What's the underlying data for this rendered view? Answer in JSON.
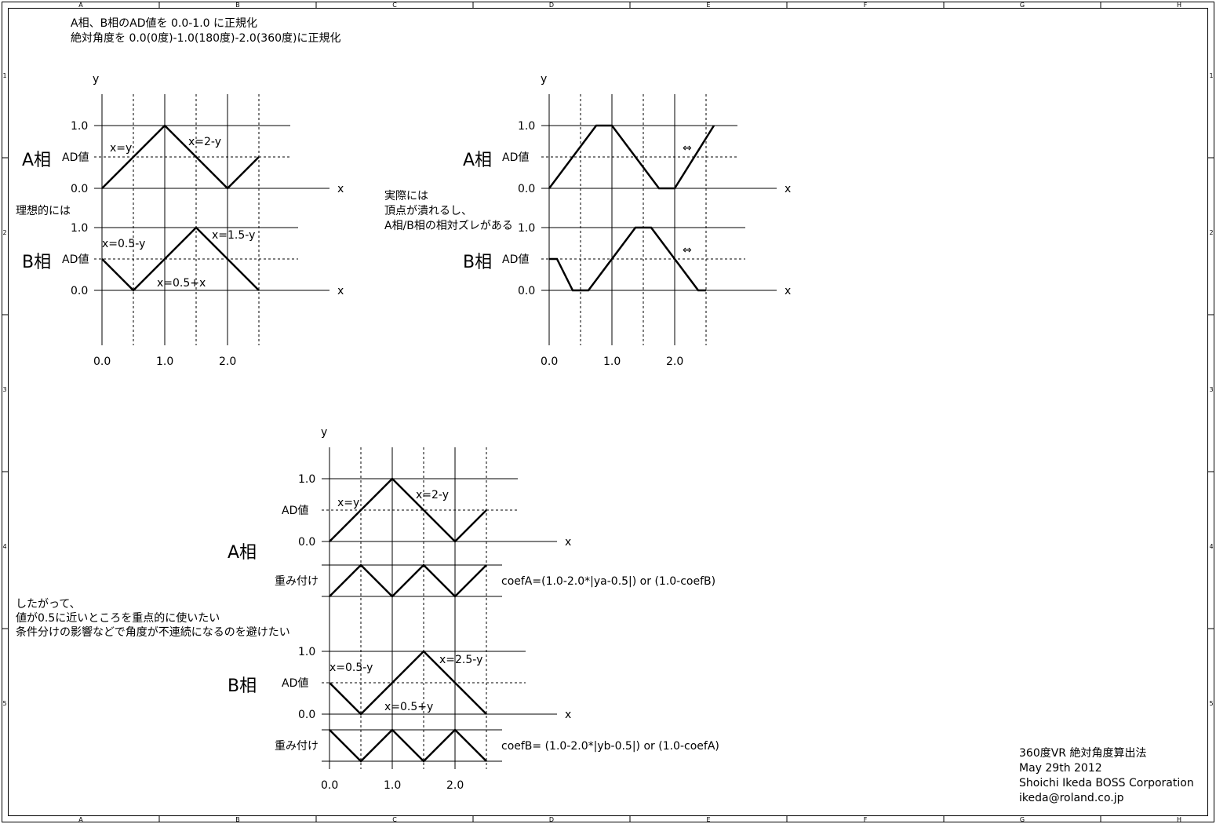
{
  "frame": {
    "columns": [
      "A",
      "B",
      "C",
      "D",
      "E",
      "F",
      "G",
      "H"
    ],
    "rows": [
      "1",
      "2",
      "3",
      "4",
      "5"
    ]
  },
  "header": {
    "line1": "A相、B相のAD値を 0.0-1.0 に正規化",
    "line2": "絶対角度を 0.0(0度)-1.0(180度)-2.0(360度)に正規化"
  },
  "labels": {
    "y": "y",
    "x": "x",
    "one": "1.0",
    "ad": "AD値",
    "zero": "0.0",
    "phase_a": "A相",
    "phase_b": "B相",
    "weight": "重み付け",
    "x_ticks": [
      "0.0",
      "1.0",
      "2.0"
    ]
  },
  "ideal": {
    "note": "理想的には",
    "a_left": "x=y",
    "a_right": "x=2-y",
    "b_left": "x=0.5-y",
    "b_right": "x=1.5-y",
    "b_mid": "x=0.5+x"
  },
  "actual": {
    "note_lines": [
      "実際には",
      "頂点が潰れるし、",
      "A相/B相の相対ズレがある"
    ],
    "arrow": "⇔"
  },
  "weighted": {
    "a_left": "x=y",
    "a_right": "x=2-y",
    "b_left": "x=0.5-y",
    "b_right": "x=2.5-y",
    "b_mid": "x=0.5+y",
    "coef_a": "coefA=(1.0-2.0*|ya-0.5|) or (1.0-coefB)",
    "coef_b": "coefB= (1.0-2.0*|yb-0.5|) or (1.0-coefA)",
    "note_lines": [
      "したがって、",
      "値が0.5に近いところを重点的に使いたい",
      "条件分けの影響などで角度が不連続になるのを避けたい"
    ]
  },
  "title_block": {
    "title": "360度VR 絶対角度算出法",
    "date": "May 29th 2012",
    "author": "Shoichi Ikeda BOSS Corporation",
    "email": "ikeda@roland.co.jp"
  },
  "chart_data": [
    {
      "type": "line",
      "title": "",
      "xlabel": "x",
      "ylabel": "y",
      "xlim": [
        0,
        2.5
      ],
      "ylim": [
        0,
        1
      ],
      "series": [
        {
          "name": "A相",
          "x": [
            0,
            1,
            2,
            2.5
          ],
          "y": [
            0,
            1,
            0,
            0.5
          ]
        },
        {
          "name": "B相",
          "x": [
            0,
            0.5,
            1.5,
            2.5
          ],
          "y": [
            0.5,
            0,
            1,
            0
          ]
        }
      ]
    },
    {
      "type": "line",
      "title": "",
      "xlabel": "x",
      "ylabel": "y",
      "xlim": [
        0,
        2.5
      ],
      "ylim": [
        0,
        1
      ],
      "series": [
        {
          "name": "A相",
          "x": [
            0,
            0.75,
            0.95,
            1.75,
            1.95,
            2.5
          ],
          "y": [
            0,
            1,
            1,
            0,
            0,
            1
          ]
        },
        {
          "name": "B相",
          "x": [
            0,
            0.1,
            0.3,
            0.5,
            1.35,
            1.55,
            2.3,
            2.5
          ],
          "y": [
            0.5,
            0.5,
            0,
            0,
            1,
            1,
            0,
            0
          ]
        }
      ]
    },
    {
      "type": "line",
      "title": "",
      "xlabel": "x",
      "ylabel": "y",
      "xlim": [
        0,
        2.5
      ],
      "ylim": [
        0,
        1
      ],
      "series": [
        {
          "name": "A相",
          "x": [
            0,
            1,
            2,
            2.5
          ],
          "y": [
            0,
            1,
            0,
            0.5
          ]
        },
        {
          "name": "A相 重み付け",
          "x": [
            0,
            0.5,
            1,
            1.5,
            2,
            2.5
          ],
          "y": [
            0,
            1,
            0,
            1,
            0,
            1
          ]
        },
        {
          "name": "B相",
          "x": [
            0,
            0.5,
            1.5,
            2.5
          ],
          "y": [
            0.5,
            0,
            1,
            0
          ]
        },
        {
          "name": "B相 重み付け",
          "x": [
            0,
            0.5,
            1,
            1.5,
            2,
            2.5
          ],
          "y": [
            1,
            0,
            1,
            0,
            1,
            0
          ]
        }
      ]
    }
  ]
}
